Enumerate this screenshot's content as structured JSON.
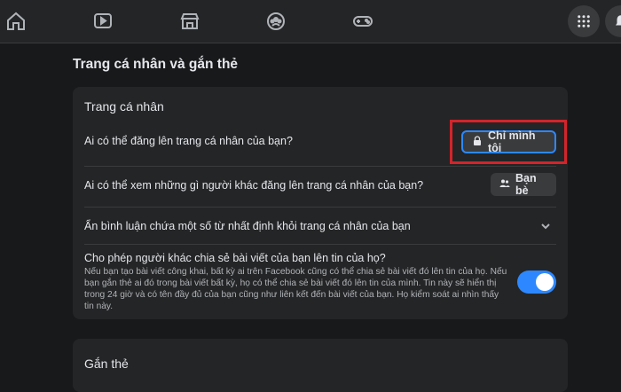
{
  "page": {
    "title": "Trang cá nhân và gắn thẻ"
  },
  "profile_card": {
    "heading": "Trang cá nhân",
    "rows": [
      {
        "question": "Ai có thể đăng lên trang cá nhân của bạn?",
        "value": "Chỉ mình tôi",
        "icon": "lock-icon"
      },
      {
        "question": "Ai có thể xem những gì người khác đăng lên trang cá nhân của bạn?",
        "value": "Bạn bè",
        "icon": "friends-icon"
      },
      {
        "question": "Ẩn bình luận chứa một số từ nhất định khỏi trang cá nhân của bạn",
        "icon": "chevron-down-icon"
      },
      {
        "question": "Cho phép người khác chia sẻ bài viết của bạn lên tin của họ?",
        "description": "Nếu bạn tạo bài viết công khai, bất kỳ ai trên Facebook cũng có thể chia sẻ bài viết đó lên tin của họ. Nếu bạn gắn thẻ ai đó trong bài viết bất kỳ, họ có thể chia sẻ bài viết đó lên tin của mình. Tin này sẽ hiển thị trong 24 giờ và có tên đầy đủ của bạn cũng như liên kết đến bài viết của bạn. Họ kiểm soát ai nhìn thấy tin này.",
        "toggle_on": true
      }
    ]
  },
  "tagging_card": {
    "heading": "Gắn thẻ"
  },
  "colors": {
    "background": "#18191a",
    "card": "#242526",
    "accent": "#2d88ff",
    "highlight": "#d4242b"
  },
  "nav": {
    "icons": [
      "home-icon",
      "video-icon",
      "marketplace-icon",
      "groups-icon",
      "gaming-icon",
      "menu-grid-icon",
      "notifications-icon"
    ]
  }
}
